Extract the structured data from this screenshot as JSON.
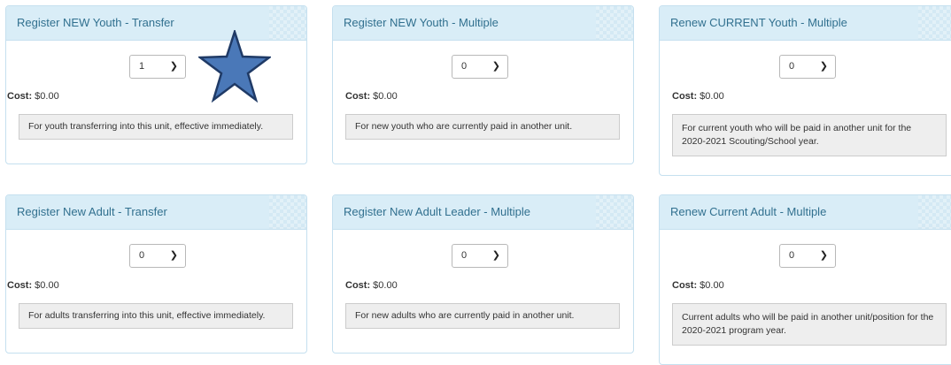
{
  "cards": [
    {
      "title": "Register NEW Youth - Transfer",
      "select_value": "1",
      "cost_label": "Cost:",
      "cost_value": "$0.00",
      "description": "For youth transferring into this unit, effective immediately."
    },
    {
      "title": "Register NEW Youth - Multiple",
      "select_value": "0",
      "cost_label": "Cost:",
      "cost_value": "$0.00",
      "description": "For new youth who are currently paid in another unit."
    },
    {
      "title": "Renew CURRENT Youth - Multiple",
      "select_value": "0",
      "cost_label": "Cost:",
      "cost_value": "$0.00",
      "description": "For current youth who will be paid in another unit for the 2020-2021 Scouting/School year."
    },
    {
      "title": "Register New Adult - Transfer",
      "select_value": "0",
      "cost_label": "Cost:",
      "cost_value": "$0.00",
      "description": "For adults transferring into this unit, effective immediately."
    },
    {
      "title": "Register New Adult Leader - Multiple",
      "select_value": "0",
      "cost_label": "Cost:",
      "cost_value": "$0.00",
      "description": "For new adults who are currently paid in another unit."
    },
    {
      "title": "Renew Current Adult - Multiple",
      "select_value": "0",
      "cost_label": "Cost:",
      "cost_value": "$0.00",
      "description": "Current adults who will be paid in another unit/position for the 2020-2021 program year."
    }
  ],
  "colors": {
    "header_bg": "#d9edf7",
    "header_text": "#31708f",
    "star_fill": "#4a78b8",
    "star_stroke": "#1f3a66"
  },
  "icons": {
    "select_chevron": "chevron-down-icon",
    "annotation": "star-icon"
  }
}
